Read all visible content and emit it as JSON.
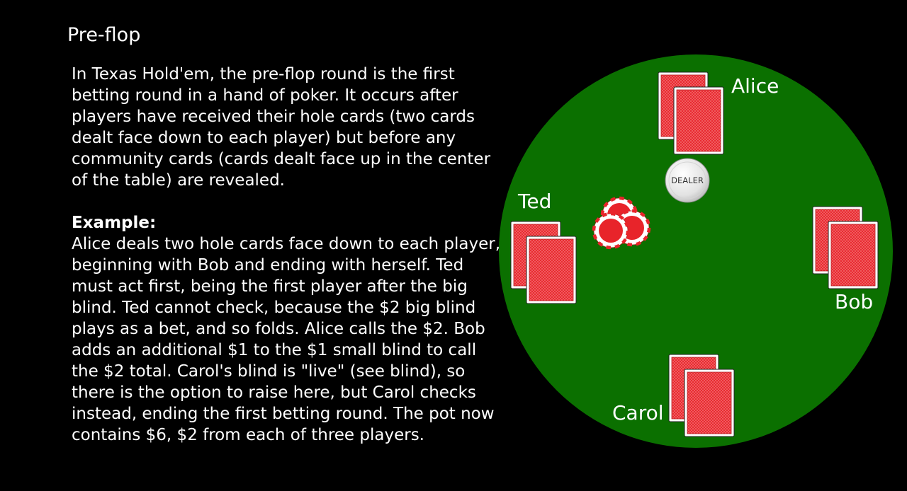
{
  "page": {
    "title": "Pre-flop",
    "intro": "In Texas Hold'em, the pre-flop round is the first betting round in a hand of poker. It occurs after players have received their hole cards (two cards dealt face down to each player) but before any community cards (cards dealt face up in the center of the table) are revealed.",
    "example_heading": "Example:",
    "example_text": "Alice deals two hole cards face down to each player, beginning with Bob and ending with herself. Ted must act first, being the first player after the big blind. Ted cannot check, because the $2 big blind plays as a bet, and so folds. Alice calls the $2. Bob adds an additional $1 to the $1 small blind to call the $2 total. Carol's blind is \"live\" (see blind), so there is the option to raise here, but Carol checks instead, ending the first betting round. The pot now contains $6, $2 from each of three players."
  },
  "table": {
    "felt_color": "#0b7000",
    "card_back_color": "#e8242a",
    "chip_color": "#e8242a",
    "dealer_button_label": "DEALER",
    "players": {
      "alice": "Alice",
      "bob": "Bob",
      "carol": "Carol",
      "ted": "Ted"
    }
  }
}
